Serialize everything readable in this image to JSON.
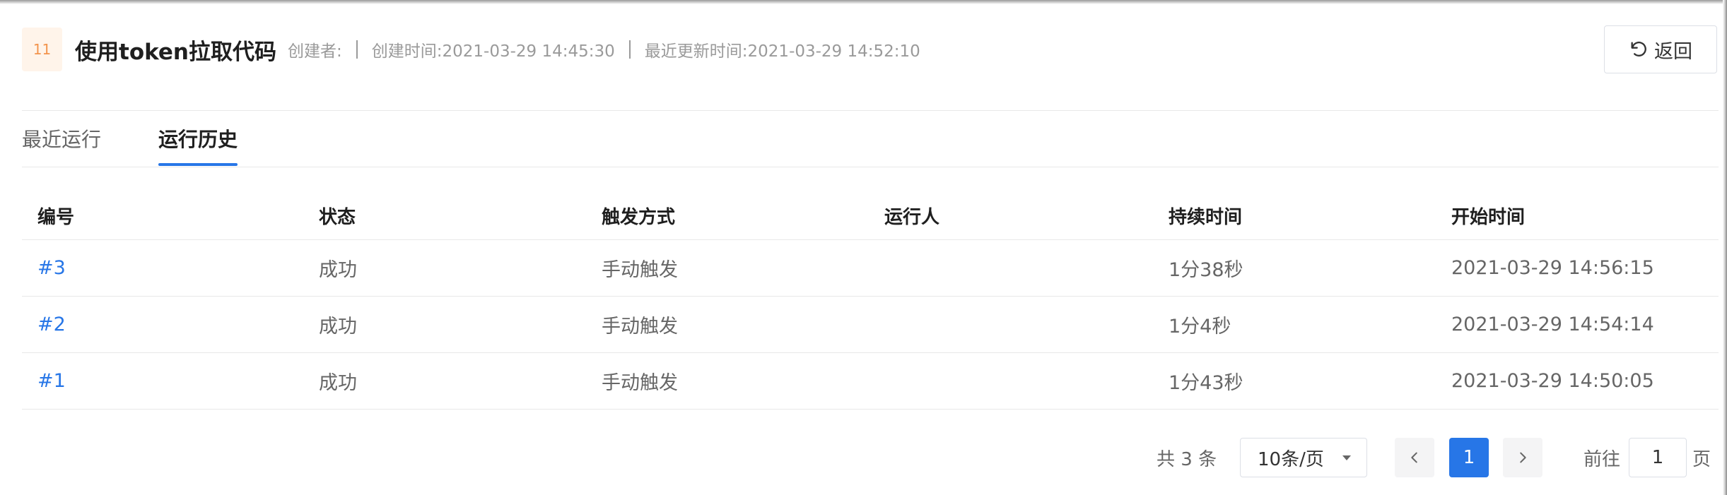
{
  "header": {
    "id_badge": "11",
    "title": "使用token拉取代码",
    "creator": "创建者:",
    "created_time": "创建时间:2021-03-29 14:45:30",
    "updated_time": "最近更新时间:2021-03-29 14:52:10",
    "back_label": "返回"
  },
  "tabs": [
    {
      "label": "最近运行",
      "active": false
    },
    {
      "label": "运行历史",
      "active": true
    }
  ],
  "table": {
    "columns": [
      "编号",
      "状态",
      "触发方式",
      "运行人",
      "持续时间",
      "开始时间"
    ],
    "rows": [
      {
        "id": "#3",
        "status": "成功",
        "trigger": "手动触发",
        "runner": "",
        "duration": "1分38秒",
        "start_time": "2021-03-29 14:56:15"
      },
      {
        "id": "#2",
        "status": "成功",
        "trigger": "手动触发",
        "runner": "",
        "duration": "1分4秒",
        "start_time": "2021-03-29 14:54:14"
      },
      {
        "id": "#1",
        "status": "成功",
        "trigger": "手动触发",
        "runner": "",
        "duration": "1分43秒",
        "start_time": "2021-03-29 14:50:05"
      }
    ]
  },
  "pagination": {
    "total_text": "共 3 条",
    "page_size": "10条/页",
    "current_page": "1",
    "goto_label": "前往",
    "goto_value": "1",
    "goto_unit": "页"
  },
  "icons": {
    "back": "undo-arrow-icon",
    "prev": "chevron-left-icon",
    "next": "chevron-right-icon",
    "select": "caret-down-icon"
  },
  "colors": {
    "accent": "#2776e7",
    "badge_bg": "#fff4ea",
    "badge_text": "#f3944d"
  }
}
